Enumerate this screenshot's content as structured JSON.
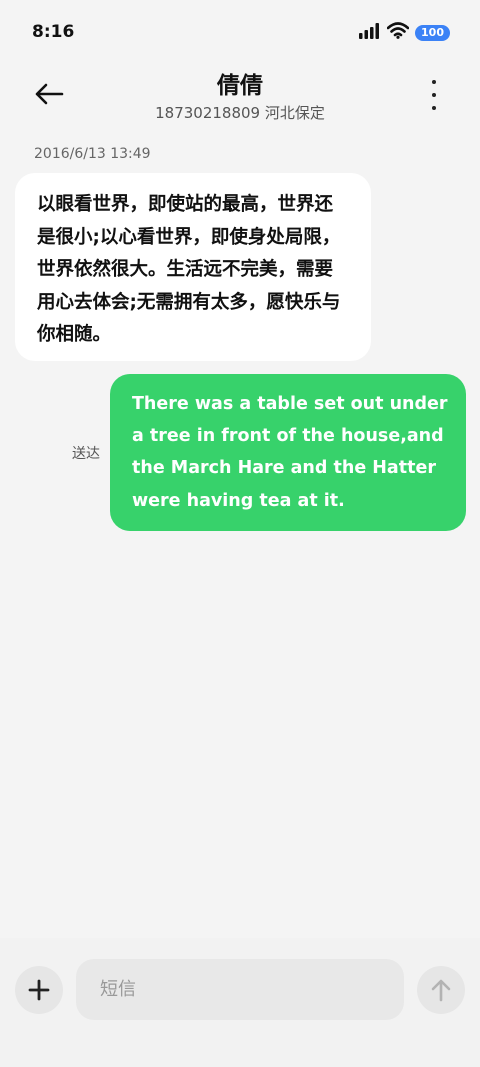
{
  "status_bar": {
    "time": "8:16",
    "battery": "100",
    "icons": [
      "signal-icon",
      "wifi-icon",
      "battery-icon"
    ]
  },
  "header": {
    "contact_name": "倩倩",
    "contact_sub": "18730218809 河北保定"
  },
  "conversation": {
    "timestamp": "2016/6/13 13:49",
    "incoming_message": "以眼看世界，即使站的最高，世界还是很小;以心看世界，即使身处局限，世界依然很大。生活远不完美，需要用心去体会;无需拥有太多，愿快乐与你相随。",
    "outgoing_message": "There was a table set out under a tree in front of the house,and the March Hare and the Hatter were having tea at it.",
    "outgoing_status": "送达"
  },
  "composer": {
    "placeholder": "短信",
    "value": ""
  },
  "colors": {
    "outgoing_bubble": "#37d26b",
    "incoming_bubble": "#ffffff",
    "battery_badge": "#3b82f6",
    "background": "#f4f4f4"
  }
}
